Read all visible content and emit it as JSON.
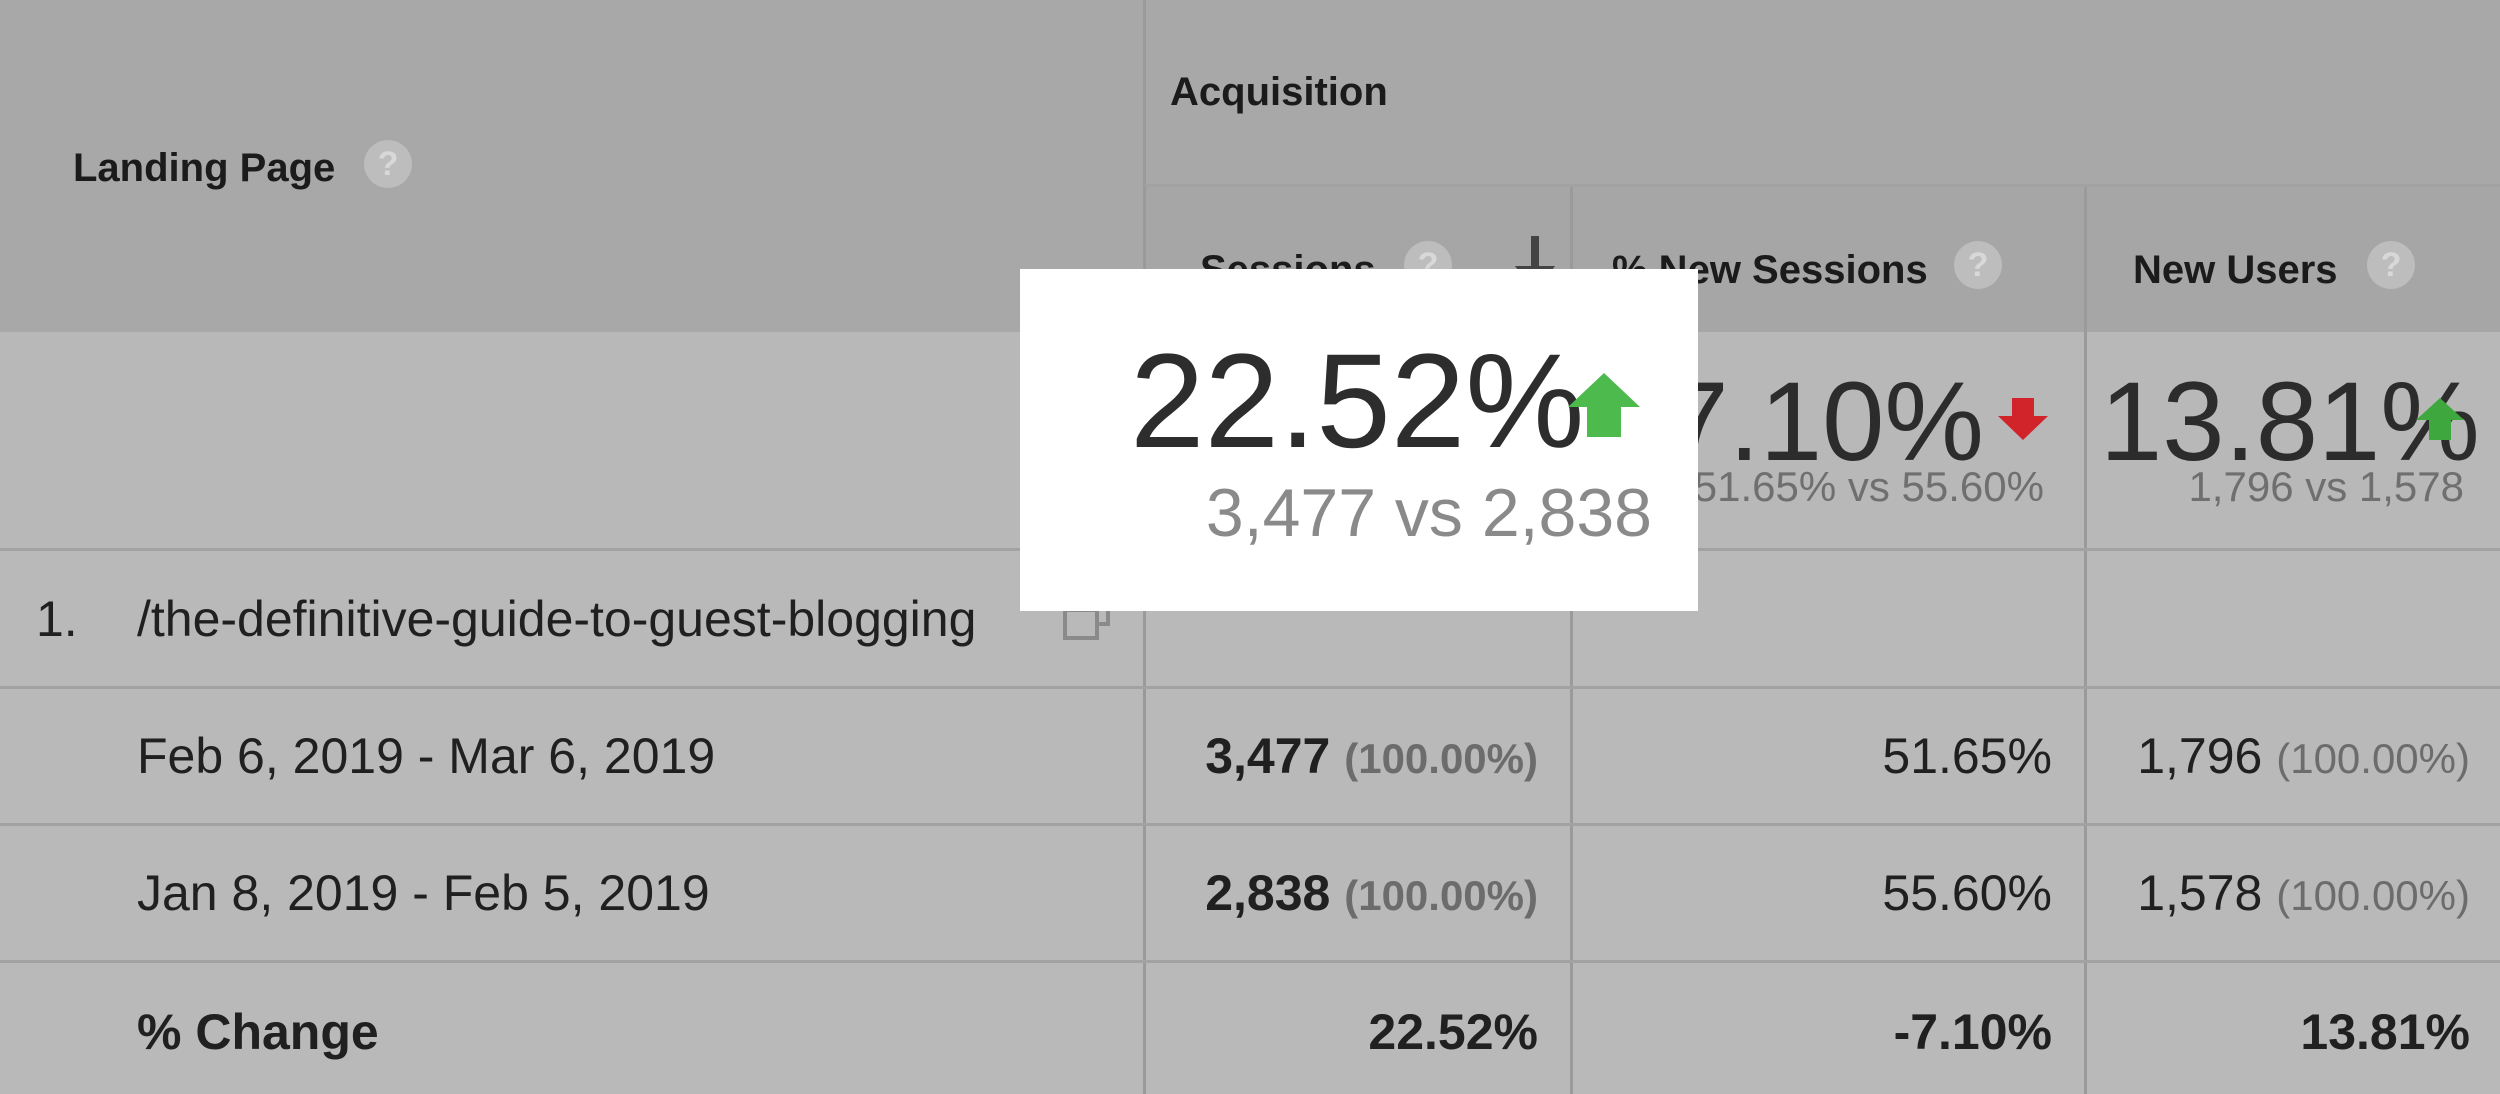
{
  "colors": {
    "up_arrow": "#3ea83e",
    "up_arrow_popup": "#4cba4c",
    "down_arrow": "#d0232a"
  },
  "header": {
    "landing_page_label": "Landing Page",
    "acquisition_label": "Acquisition",
    "help_glyph": "?",
    "columns": {
      "sessions": "Sessions",
      "new_sessions_pct": "% New Sessions",
      "new_users": "New Users"
    }
  },
  "summary": {
    "sessions": {
      "change": "22.52%",
      "compare": "3,477 vs 2,838",
      "direction": "up"
    },
    "new_sessions_pct": {
      "change": "7.10%",
      "compare": "51.65% vs 55.60%",
      "direction": "down"
    },
    "new_users": {
      "change": "13.81%",
      "compare": "1,796 vs 1,578",
      "direction": "up"
    }
  },
  "rows": {
    "page_index": "1.",
    "page_path": "/the-definitive-guide-to-guest-blogging",
    "periods": [
      {
        "label": "Feb 6, 2019 - Mar 6, 2019",
        "sessions": "3,477",
        "sessions_pct": "(100.00%)",
        "new_sessions_pct": "51.65%",
        "new_users": "1,796",
        "new_users_pct": "(100.00%)"
      },
      {
        "label": "Jan 8, 2019 - Feb 5, 2019",
        "sessions": "2,838",
        "sessions_pct": "(100.00%)",
        "new_sessions_pct": "55.60%",
        "new_users": "1,578",
        "new_users_pct": "(100.00%)"
      }
    ],
    "change": {
      "label": "% Change",
      "sessions": "22.52%",
      "new_sessions_pct": "-7.10%",
      "new_users": "13.81%"
    }
  },
  "popup": {
    "value": "22.52%",
    "compare": "3,477 vs 2,838",
    "direction": "up"
  }
}
